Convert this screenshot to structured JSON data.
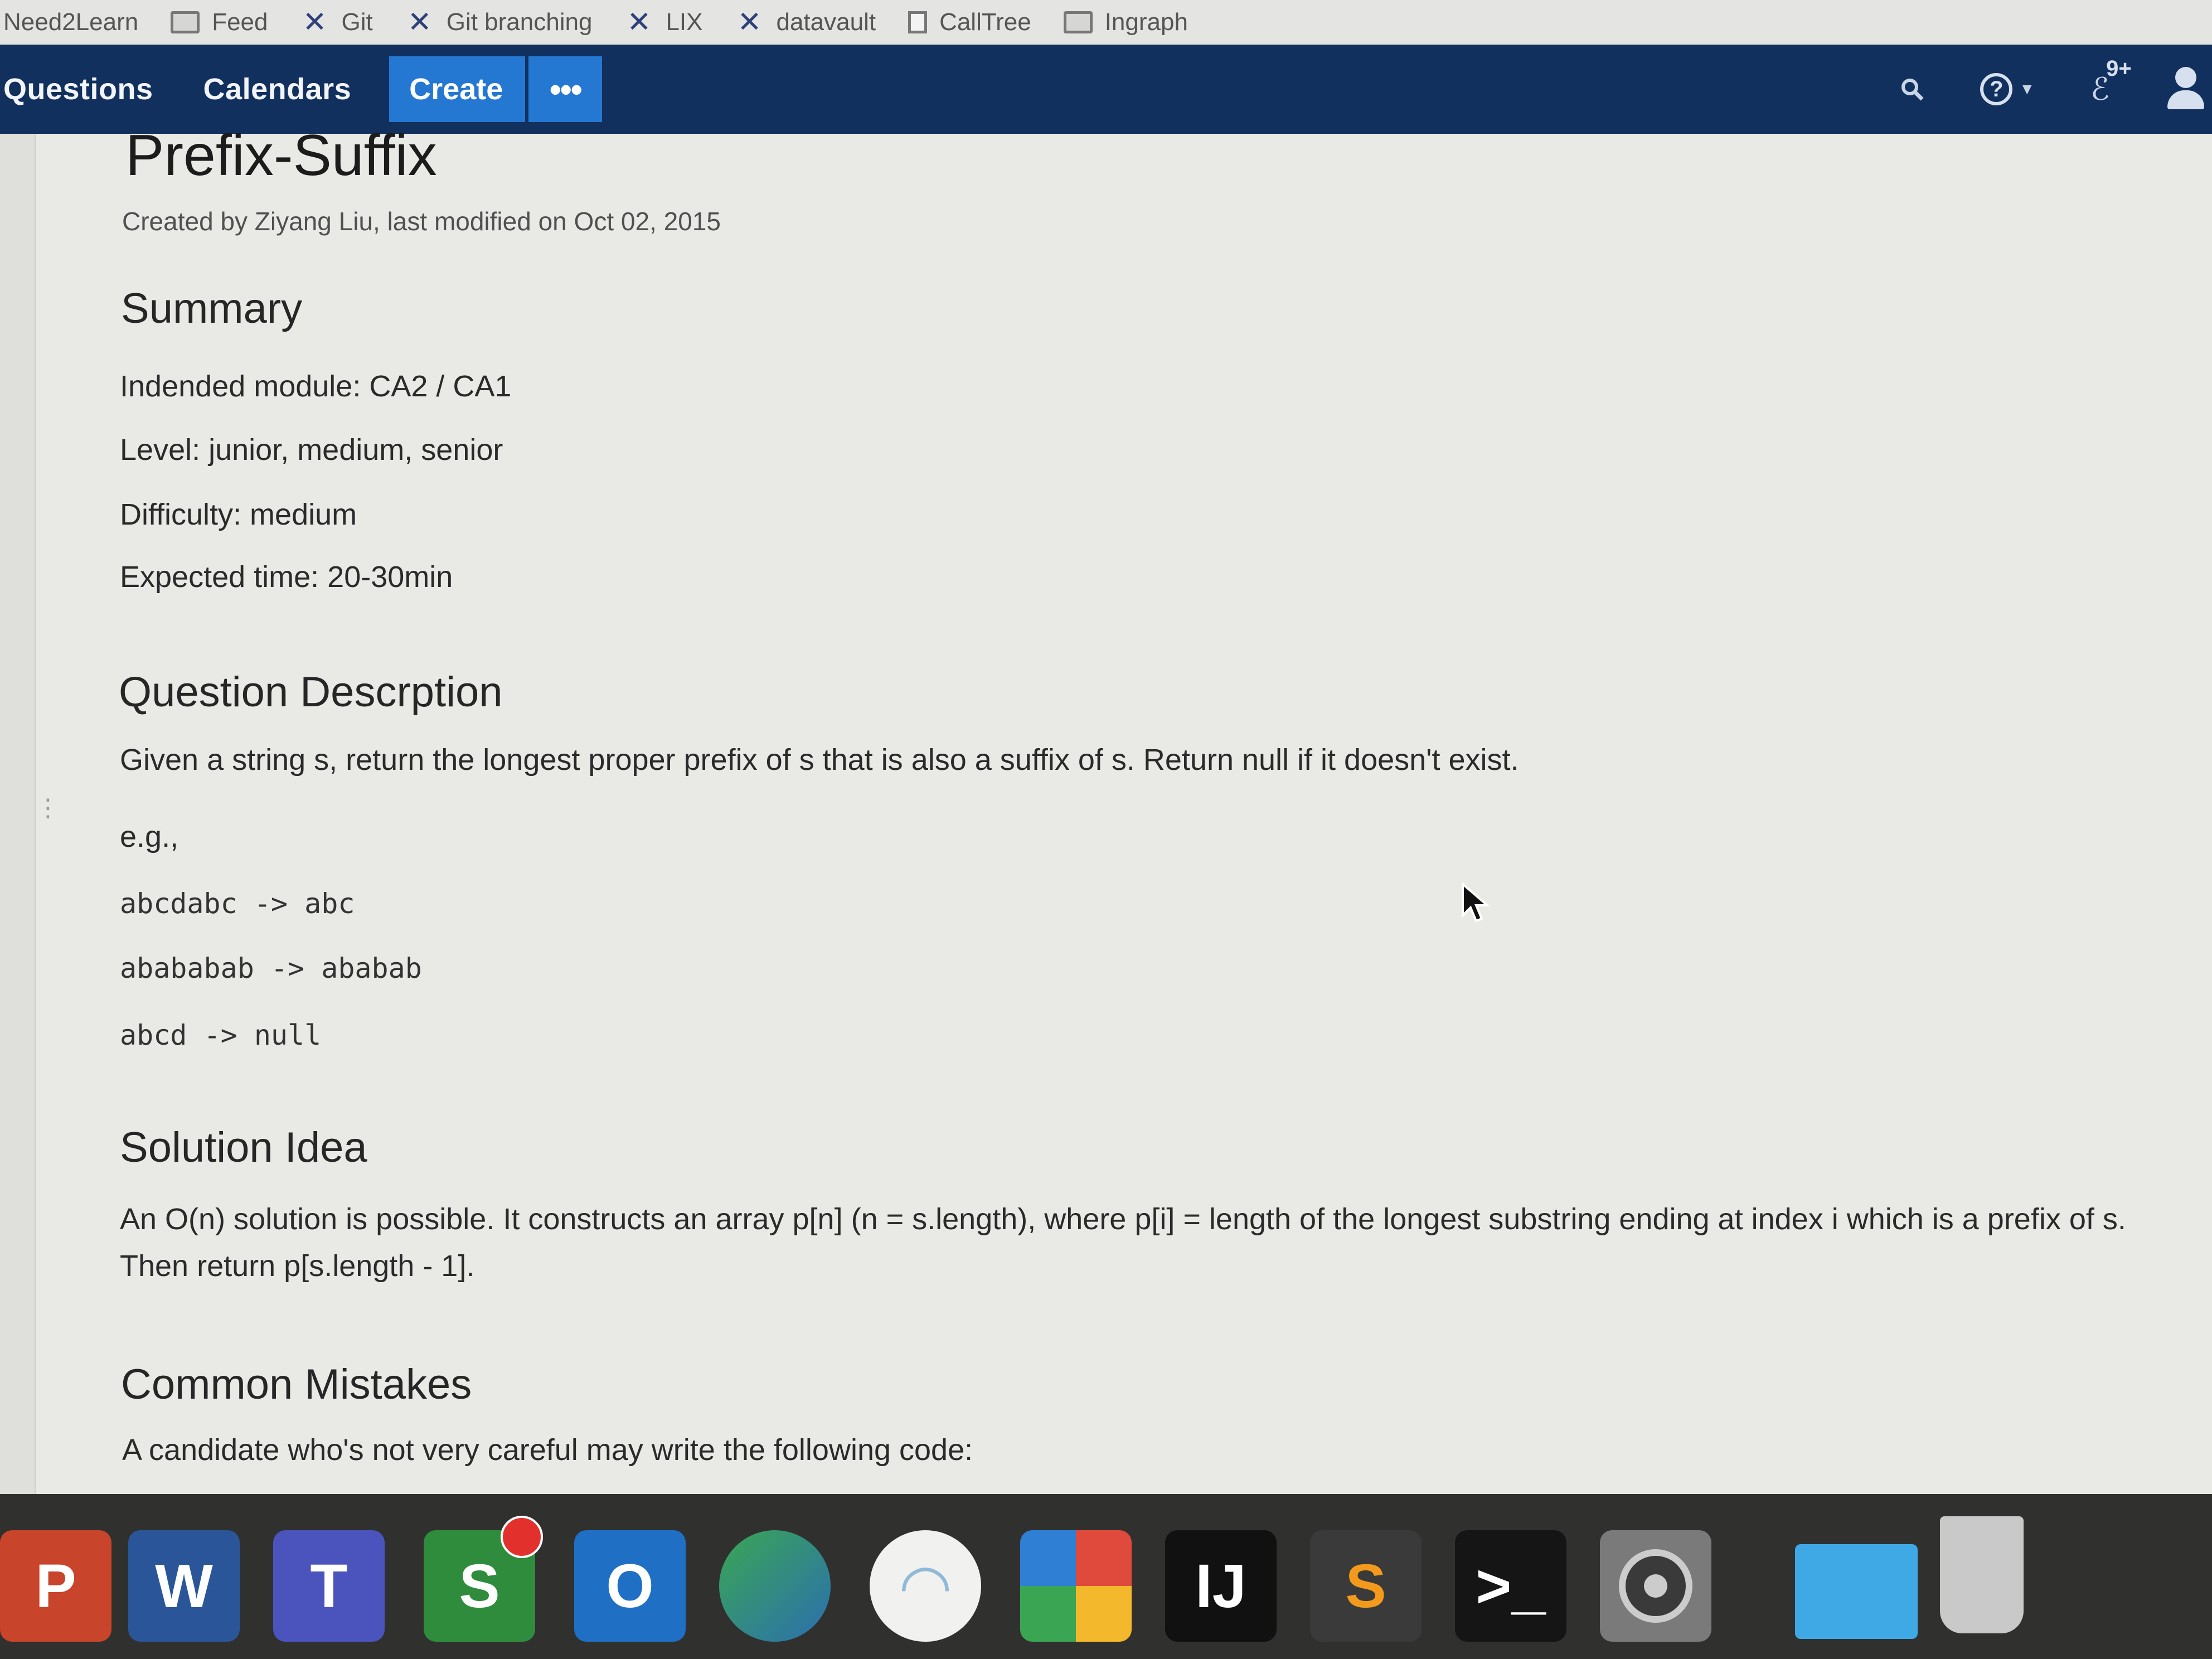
{
  "bookmarks": [
    {
      "label": "Need2Learn",
      "icon": "none"
    },
    {
      "label": "Feed",
      "icon": "folder-icon"
    },
    {
      "label": "Git",
      "icon": "tool-icon"
    },
    {
      "label": "Git branching",
      "icon": "tool-icon"
    },
    {
      "label": "LIX",
      "icon": "tool-icon"
    },
    {
      "label": "datavault",
      "icon": "tool-icon"
    },
    {
      "label": "CallTree",
      "icon": "page-icon"
    },
    {
      "label": "Ingraph",
      "icon": "folder-icon"
    }
  ],
  "nav": {
    "questions": "Questions",
    "calendars": "Calendars",
    "create": "Create",
    "more": "•••",
    "notification_count": "9+"
  },
  "page": {
    "title": "Prefix-Suffix",
    "byline": "Created by Ziyang Liu, last modified on Oct 02, 2015",
    "summary_heading": "Summary",
    "module": "Indended module: CA2 / CA1",
    "level": "Level: junior, medium, senior",
    "difficulty": "Difficulty: medium",
    "expected_time": "Expected time: 20-30min",
    "question_heading": "Question Descrption",
    "question_text": "Given a string s, return the longest proper prefix of s that is also a suffix of s. Return null if it doesn't exist.",
    "eg": "e.g.,",
    "examples": [
      "abcdabc -> abc",
      "abababab -> ababab",
      "abcd -> null"
    ],
    "solution_heading": "Solution Idea",
    "solution_text": "An O(n) solution is possible. It constructs an array p[n] (n = s.length), where p[i] = length of the longest substring ending at index i which is a prefix of s. Then return p[s.length - 1].",
    "mistakes_heading": "Common Mistakes",
    "mistakes_text": "A candidate who's not very careful may write the following code:"
  },
  "dock": [
    {
      "name": "powerpoint",
      "letter": "P",
      "color": "#c8442a"
    },
    {
      "name": "word",
      "letter": "W",
      "color": "#2a5699"
    },
    {
      "name": "teams",
      "letter": "T",
      "color": "#4b53bc"
    },
    {
      "name": "skype-for-business",
      "letter": "S",
      "color": "#2f8c3c"
    },
    {
      "name": "outlook",
      "letter": "O",
      "color": "#1f6fc5"
    },
    {
      "name": "vpn",
      "letter": "",
      "color": "#2b6fb0"
    },
    {
      "name": "wifi",
      "letter": "",
      "color": "#f1f1ef"
    },
    {
      "name": "app-store-grid",
      "letter": "",
      "color": "#e9a02a"
    },
    {
      "name": "intellij",
      "letter": "IJ",
      "color": "#111111"
    },
    {
      "name": "sublime-text",
      "letter": "S",
      "color": "#3a3a3a"
    },
    {
      "name": "terminal",
      "letter": ">_",
      "color": "#151515"
    },
    {
      "name": "system-preferences",
      "letter": "",
      "color": "#8a8a8a"
    },
    {
      "name": "downloads",
      "letter": "",
      "color": "#3fa9e6"
    },
    {
      "name": "trash",
      "letter": "",
      "color": "#c9c9c9"
    }
  ],
  "colors": {
    "nav_bg": "#12305e",
    "create_btn": "#2478d2",
    "page_bg": "#e9eae6",
    "dock_bg": "#30302e"
  }
}
